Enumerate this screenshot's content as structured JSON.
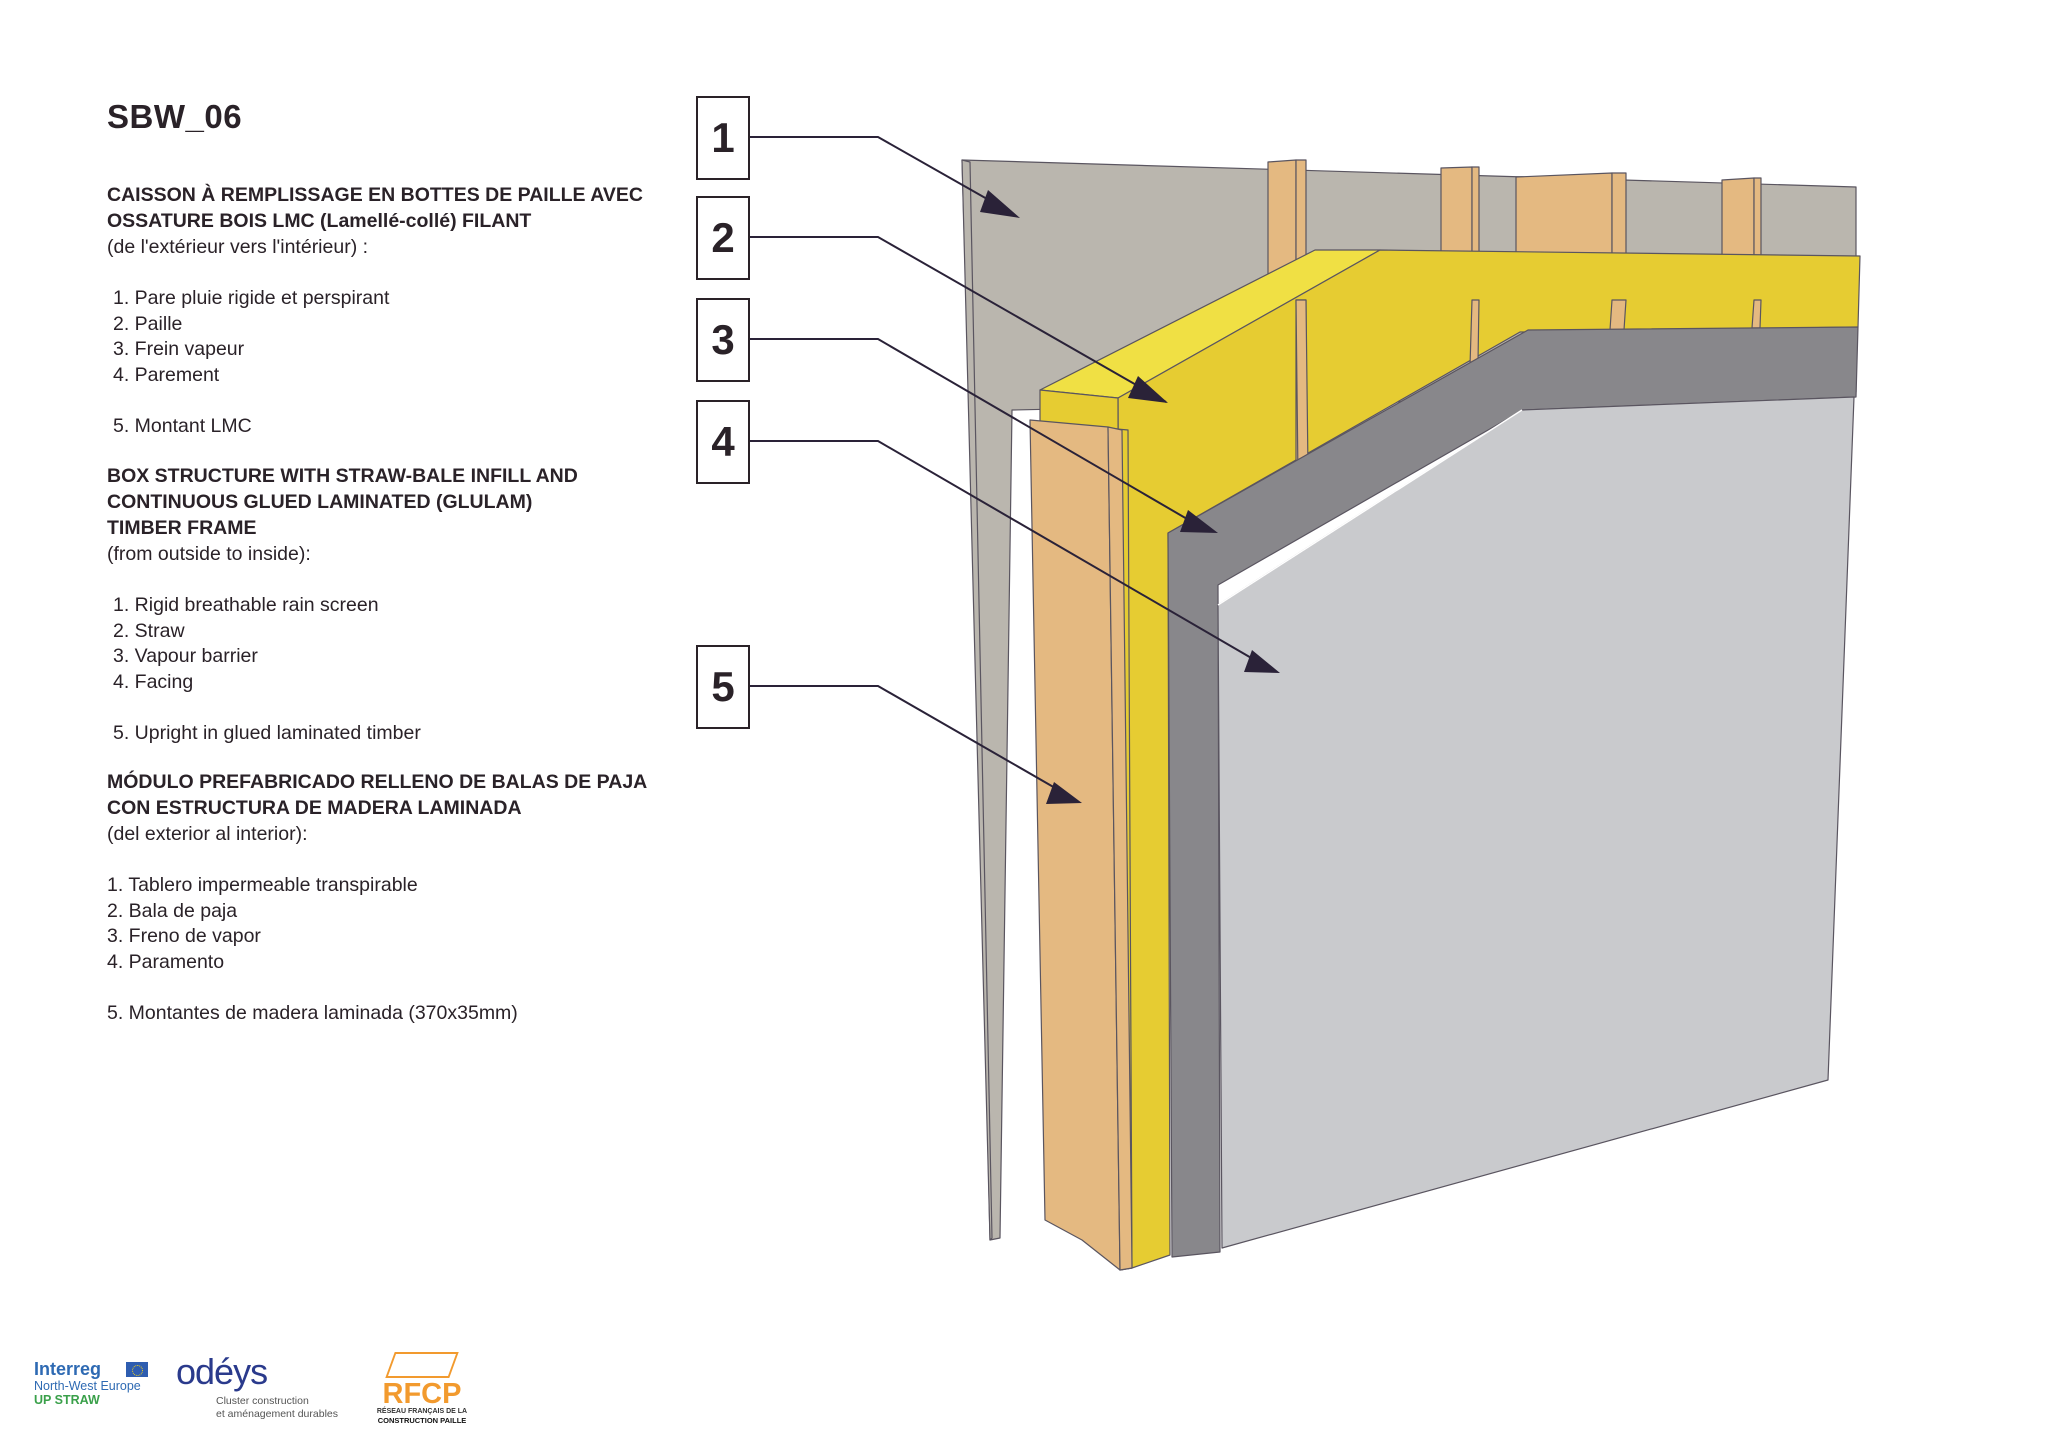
{
  "sheet": {
    "code": "SBW_06"
  },
  "descriptions": {
    "french": {
      "title_line1": "CAISSON À REMPLISSAGE EN BOTTES DE PAILLE AVEC",
      "title_line2": "OSSATURE BOIS LMC (Lamellé-collé) FILANT",
      "direction": "(de l'extérieur vers l'intérieur) :",
      "layers": [
        "1. Pare pluie rigide et perspirant",
        "2. Paille",
        "3. Frein vapeur",
        "4. Parement"
      ],
      "structure": "5. Montant LMC"
    },
    "english": {
      "title_line1": "BOX STRUCTURE WITH STRAW-BALE INFILL AND",
      "title_line2": "CONTINUOUS GLUED LAMINATED (GLULAM)",
      "title_line3": "TIMBER FRAME",
      "direction": "(from outside to inside):",
      "layers": [
        "1. Rigid breathable rain screen",
        "2. Straw",
        "3. Vapour barrier",
        "4. Facing"
      ],
      "structure": "5. Upright in glued laminated timber"
    },
    "spanish": {
      "title_line1": "MÓDULO PREFABRICADO RELLENO DE BALAS DE PAJA",
      "title_line2": "CON ESTRUCTURA DE MADERA LAMINADA",
      "direction": "(del exterior al interior):",
      "layers": [
        "1. Tablero impermeable transpirable",
        "2. Bala de paja",
        "3. Freno de vapor",
        "4. Paramento"
      ],
      "structure": "5. Montantes de madera laminada (370x35mm)"
    }
  },
  "diagram": {
    "callouts": [
      "1",
      "2",
      "3",
      "4",
      "5"
    ],
    "colors": {
      "rain_screen": "#bab6ae",
      "straw_front": "#e6cc32",
      "straw_top": "#f0e044",
      "timber": "#e4b981",
      "vapour_barrier": "#88878b",
      "facing": "#c9cacd",
      "leader": "#2a2238"
    }
  },
  "logos": {
    "interreg": {
      "name": "Interreg",
      "region": "North-West Europe",
      "project": "UP STRAW"
    },
    "odeys": {
      "name": "odéys",
      "tagline_line1": "Cluster construction",
      "tagline_line2": "et aménagement durables"
    },
    "rfcp": {
      "name": "RFCP",
      "line1": "RÉSEAU FRANÇAIS DE LA",
      "line2": "CONSTRUCTION PAILLE"
    }
  }
}
